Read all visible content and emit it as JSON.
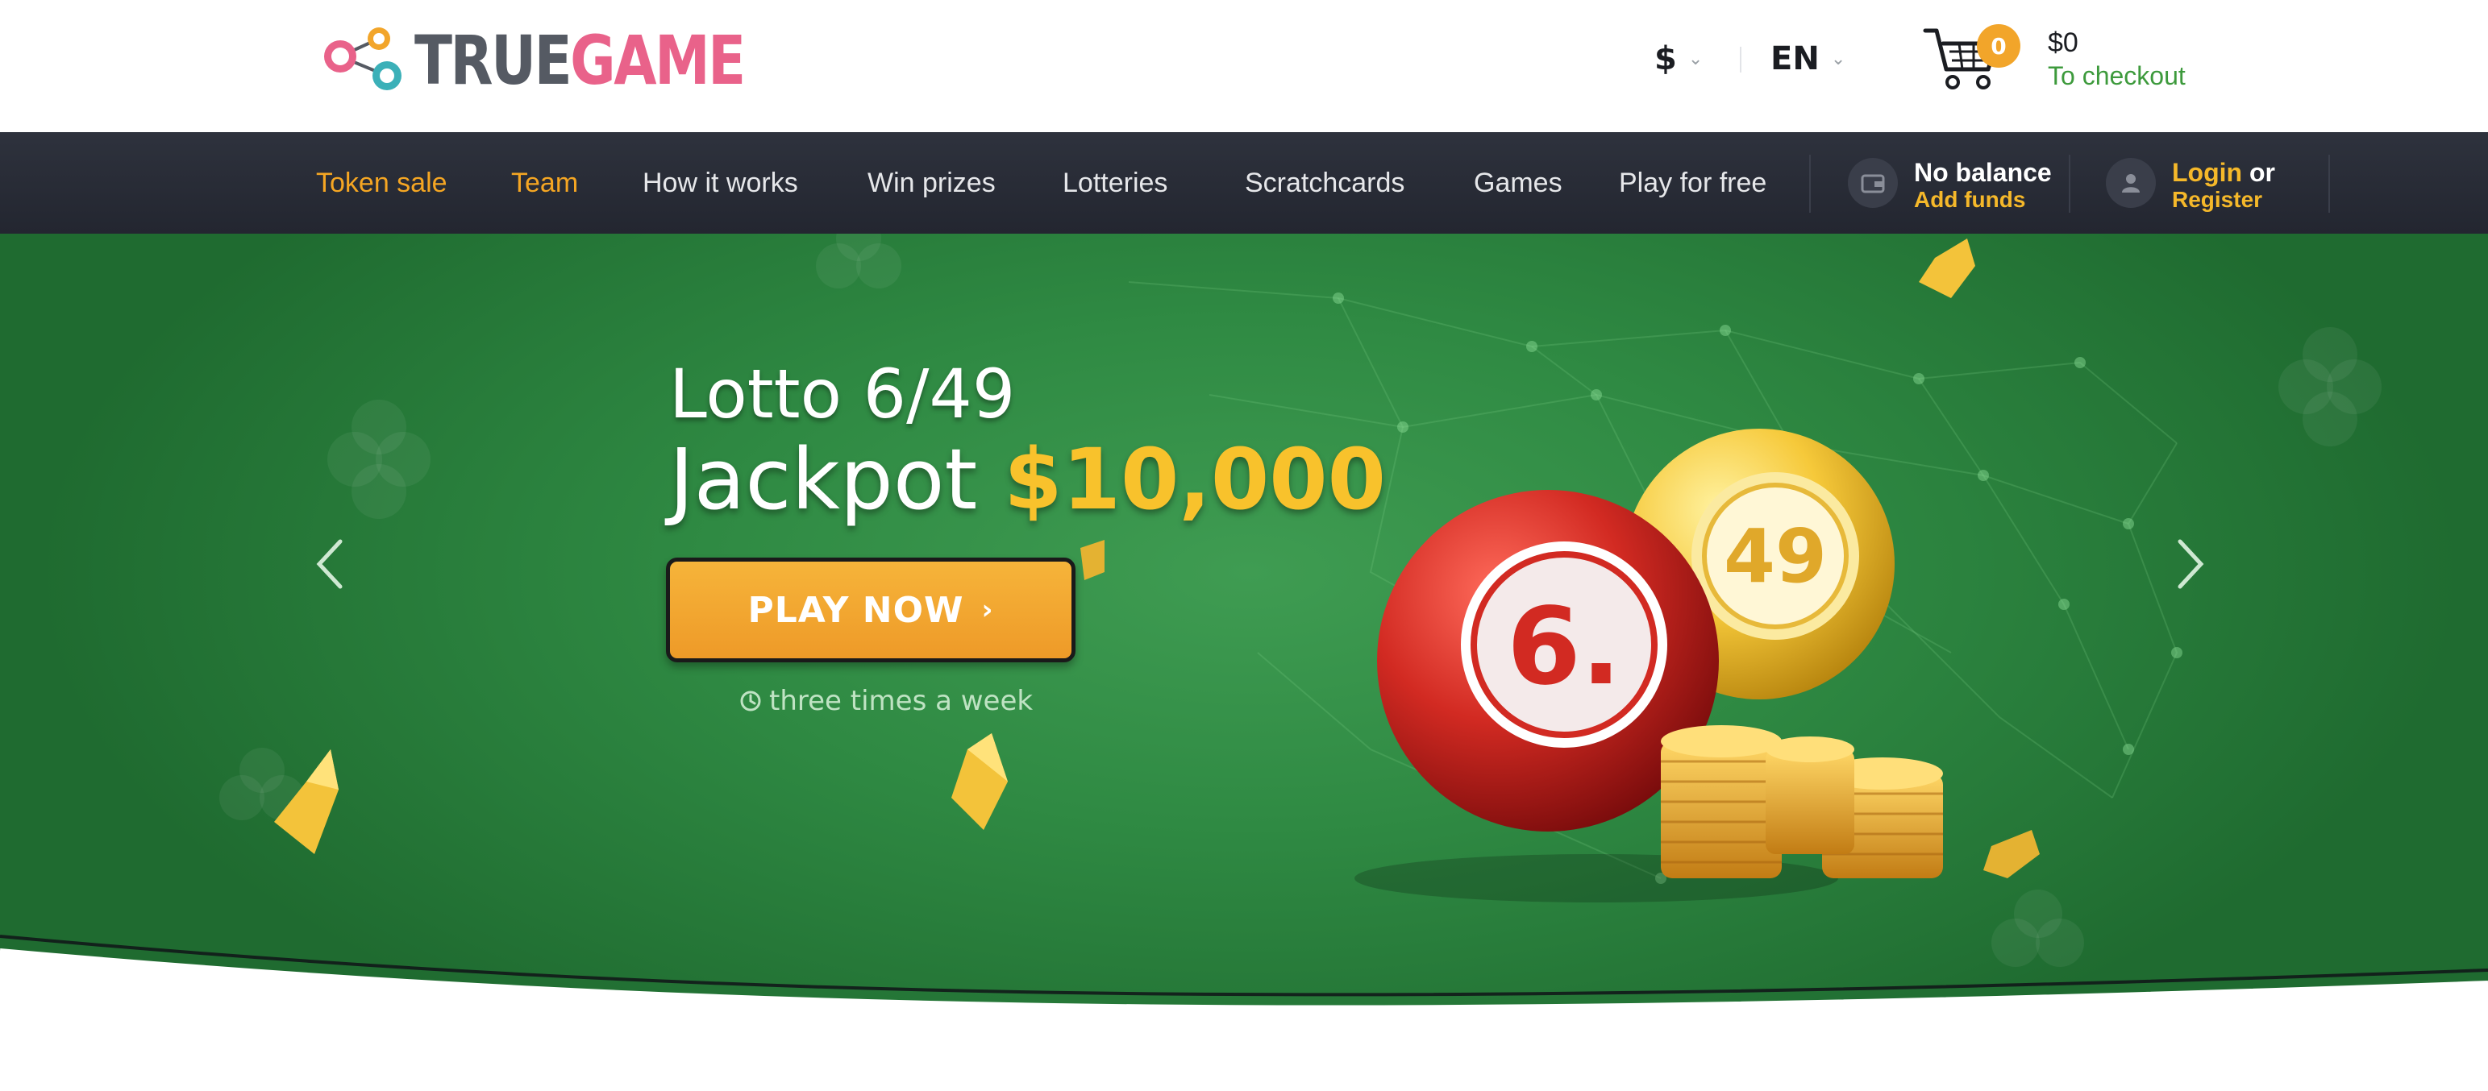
{
  "header": {
    "logo": {
      "part1": "TRUE",
      "part2": "GAME"
    },
    "currency": "$",
    "language": "EN",
    "cart": {
      "count": "0",
      "amount": "$0",
      "checkout_label": "To checkout"
    }
  },
  "nav": {
    "items": [
      {
        "label": "Token sale",
        "highlight": true
      },
      {
        "label": "Team",
        "highlight": true
      },
      {
        "label": "How it works",
        "highlight": false
      },
      {
        "label": "Win prizes",
        "highlight": false
      },
      {
        "label": "Lotteries",
        "highlight": false
      },
      {
        "label": "Scratchcards",
        "highlight": false
      },
      {
        "label": "Games",
        "highlight": false
      },
      {
        "label": "Play for free",
        "highlight": false
      }
    ],
    "balance": {
      "title": "No balance",
      "action": "Add funds"
    },
    "account": {
      "login": "Login",
      "or": " or",
      "register": "Register"
    }
  },
  "hero": {
    "title": "Lotto 6/49",
    "jackpot_label": "Jackpot",
    "jackpot_amount": "$10,000",
    "cta": "PLAY NOW",
    "frequency": "three times a week",
    "ball_red_number": "6.",
    "ball_yellow_number": "49"
  },
  "colors": {
    "accent_orange": "#f5a623",
    "logo_pink": "#e9628a",
    "checkout_green": "#3d9a3c",
    "nav_bg": "#2a2d37",
    "hero_green": "#2f8a43",
    "jackpot_yellow": "#f8c22c"
  },
  "icons": [
    "cart-icon",
    "wallet-icon",
    "user-icon",
    "clock-icon",
    "chevron-left-icon",
    "chevron-right-icon",
    "chevron-down-icon"
  ]
}
